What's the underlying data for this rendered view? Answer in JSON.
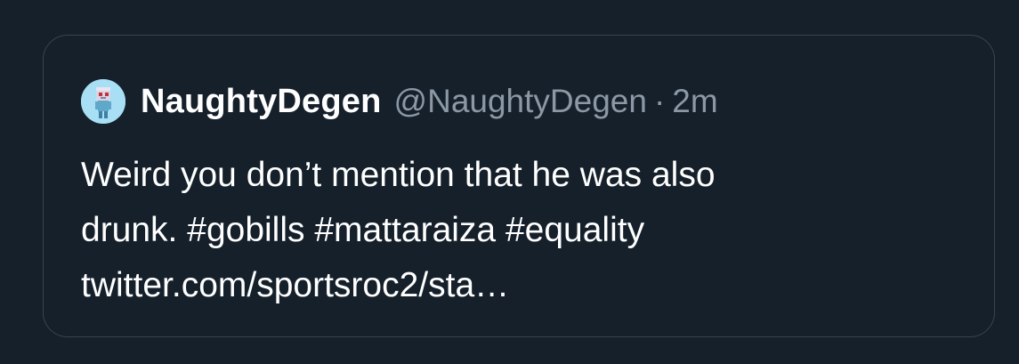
{
  "tweet": {
    "author": {
      "display_name": "NaughtyDegen",
      "handle": "@NaughtyDegen",
      "avatar_icon": "pixel-character-avatar-icon"
    },
    "separator": "·",
    "timestamp": "2m",
    "text_line1": "Weird you don’t mention that he was also",
    "text_line2_prefix": "drunk.",
    "hashtags": [
      "#gobills",
      "#mattaraiza",
      "#equality"
    ],
    "link": "twitter.com/sportsroc2/sta…"
  },
  "colors": {
    "background": "#15202b",
    "border": "#38444d",
    "secondary_text": "#8b98a5",
    "avatar_bg": "#a8dff5"
  }
}
